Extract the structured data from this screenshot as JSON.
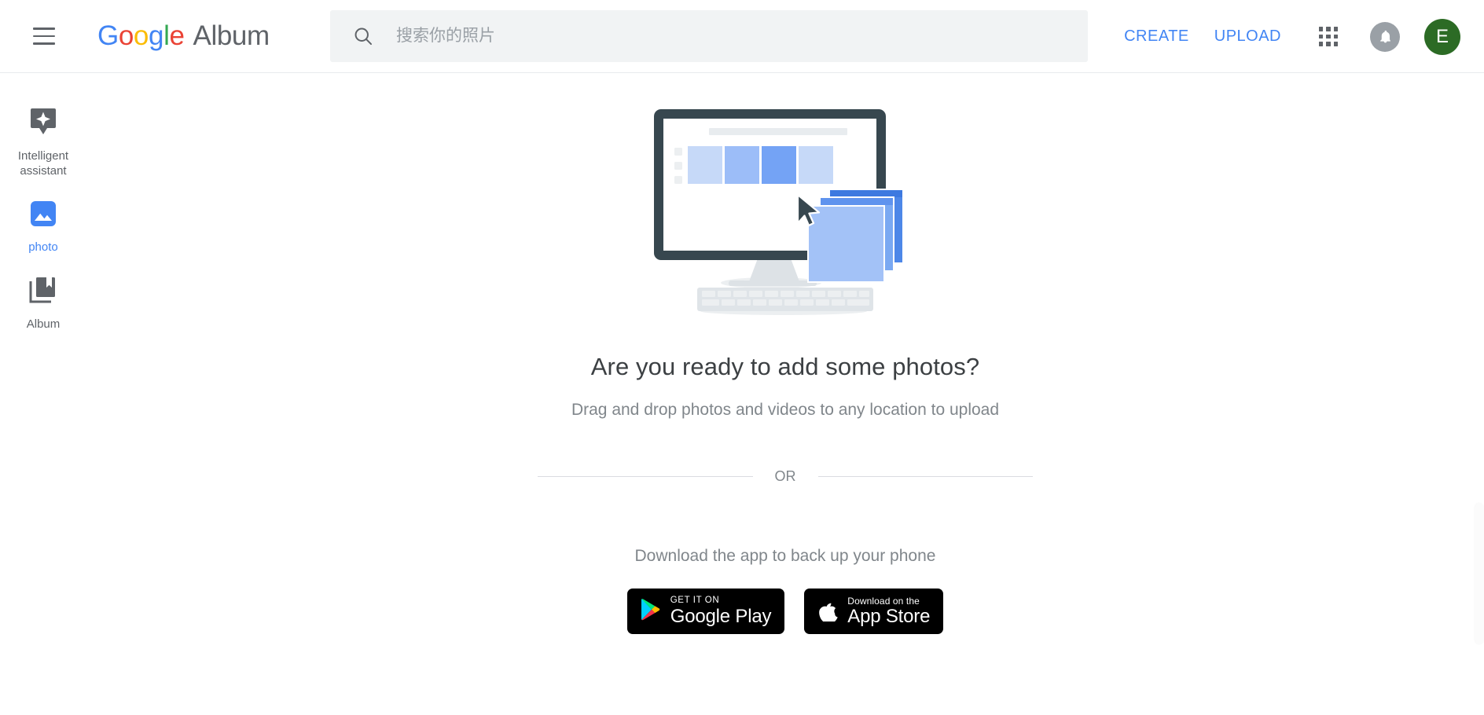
{
  "header": {
    "menu_icon": "hamburger-menu-icon",
    "brand": {
      "letters": [
        "G",
        "o",
        "o",
        "g",
        "l",
        "e"
      ],
      "g1": "G",
      "o1": "o",
      "o2": "o",
      "g2": "g",
      "l1": "l",
      "e1": "e",
      "suffix": "Album",
      "colors": {
        "blue": "#4285F4",
        "red": "#EA4335",
        "yellow": "#FBBC05",
        "green": "#34A853",
        "gray": "#5f6368"
      }
    },
    "search": {
      "icon": "search-icon",
      "placeholder": "搜索你的照片",
      "value": ""
    },
    "create_label": "CREATE",
    "upload_label": "UPLOAD",
    "apps_icon": "apps-grid-icon",
    "notifications_icon": "bell-icon",
    "avatar_letter": "E",
    "avatar_color": "#2c6b25",
    "accent_color": "#4285F4"
  },
  "sidebar": {
    "items": [
      {
        "label": "Intelligent assistant",
        "icon": "assistant-sparkle-icon",
        "active": false
      },
      {
        "label": "photo",
        "icon": "photo-icon",
        "active": true
      },
      {
        "label": "Album",
        "icon": "album-book-icon",
        "active": false
      }
    ]
  },
  "main": {
    "illustration": "desktop-monitor-with-photos-illustration",
    "headline": "Are you ready to add some photos?",
    "subhead": "Drag and drop photos and videos to any location to upload",
    "or_text": "OR",
    "download_text": "Download the app to back up your phone",
    "badges": [
      {
        "icon": "google-play-icon",
        "small": "GET IT ON",
        "big": "Google Play"
      },
      {
        "icon": "apple-icon",
        "small": "Download on the",
        "big": "App Store"
      }
    ]
  }
}
